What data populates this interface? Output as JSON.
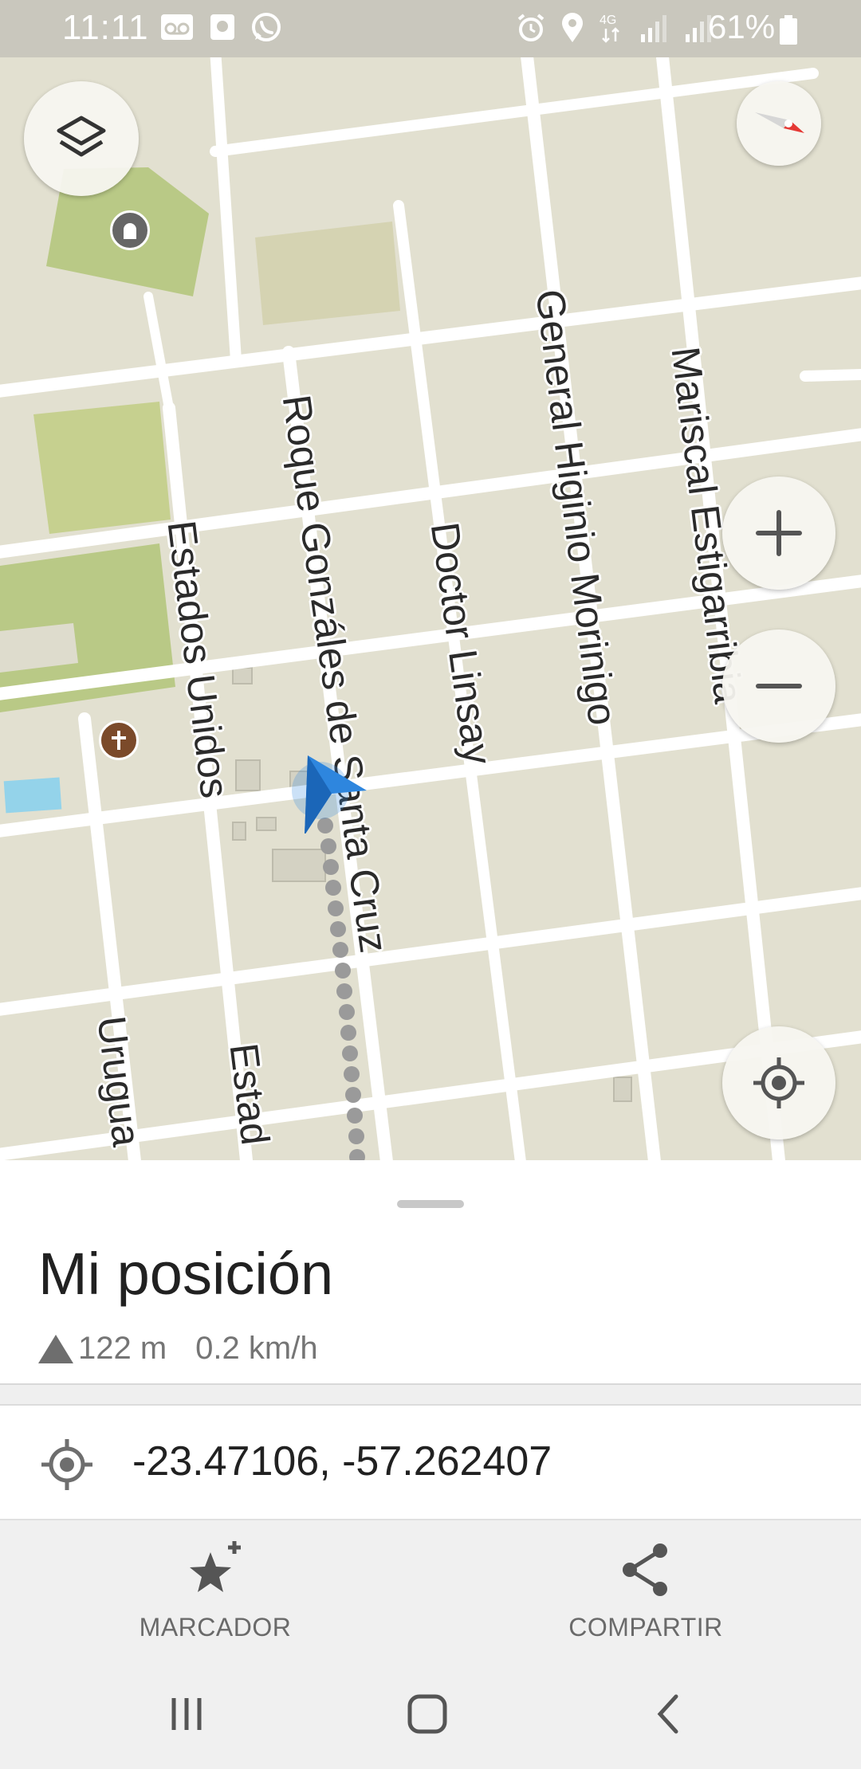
{
  "status_bar": {
    "time": "11:11",
    "battery_percent": "61%",
    "network": "4G",
    "left_icons": [
      "voicemail-icon",
      "image-notification-icon",
      "whatsapp-icon"
    ],
    "right_icons": [
      "alarm-icon",
      "location-pin-icon",
      "signal-icon",
      "signal-icon",
      "battery-icon"
    ]
  },
  "map": {
    "street_labels": [
      "Estados Unidos",
      "Roque Gonzáles de Santa Cruz",
      "Doctor Linsay",
      "General Higinio Morinigo",
      "Mariscal Estigarribia",
      "Urugua",
      "Estad"
    ],
    "pois": [
      "memorial-icon",
      "church-icon"
    ],
    "controls": {
      "layers": "layers-icon",
      "compass": "compass-icon",
      "zoom_in": "zoom-in-icon",
      "zoom_out": "zoom-out-icon",
      "my_location": "my-location-icon"
    },
    "position_marker": "position-arrow-icon",
    "colors": {
      "background": "#e2e0d0",
      "road": "#ffffff",
      "park": "#b9c986",
      "water": "#94d3ea",
      "marker": "#2e86de",
      "track": "#9a9a9a"
    }
  },
  "sheet": {
    "title": "Mi posición",
    "altitude": "122 m",
    "speed": "0.2 km/h",
    "coordinates": "-23.47106, -57.262407"
  },
  "actions": {
    "bookmark_label": "MARCADOR",
    "share_label": "COMPARTIR"
  },
  "nav": [
    "recent-apps-icon",
    "home-icon",
    "back-icon"
  ]
}
